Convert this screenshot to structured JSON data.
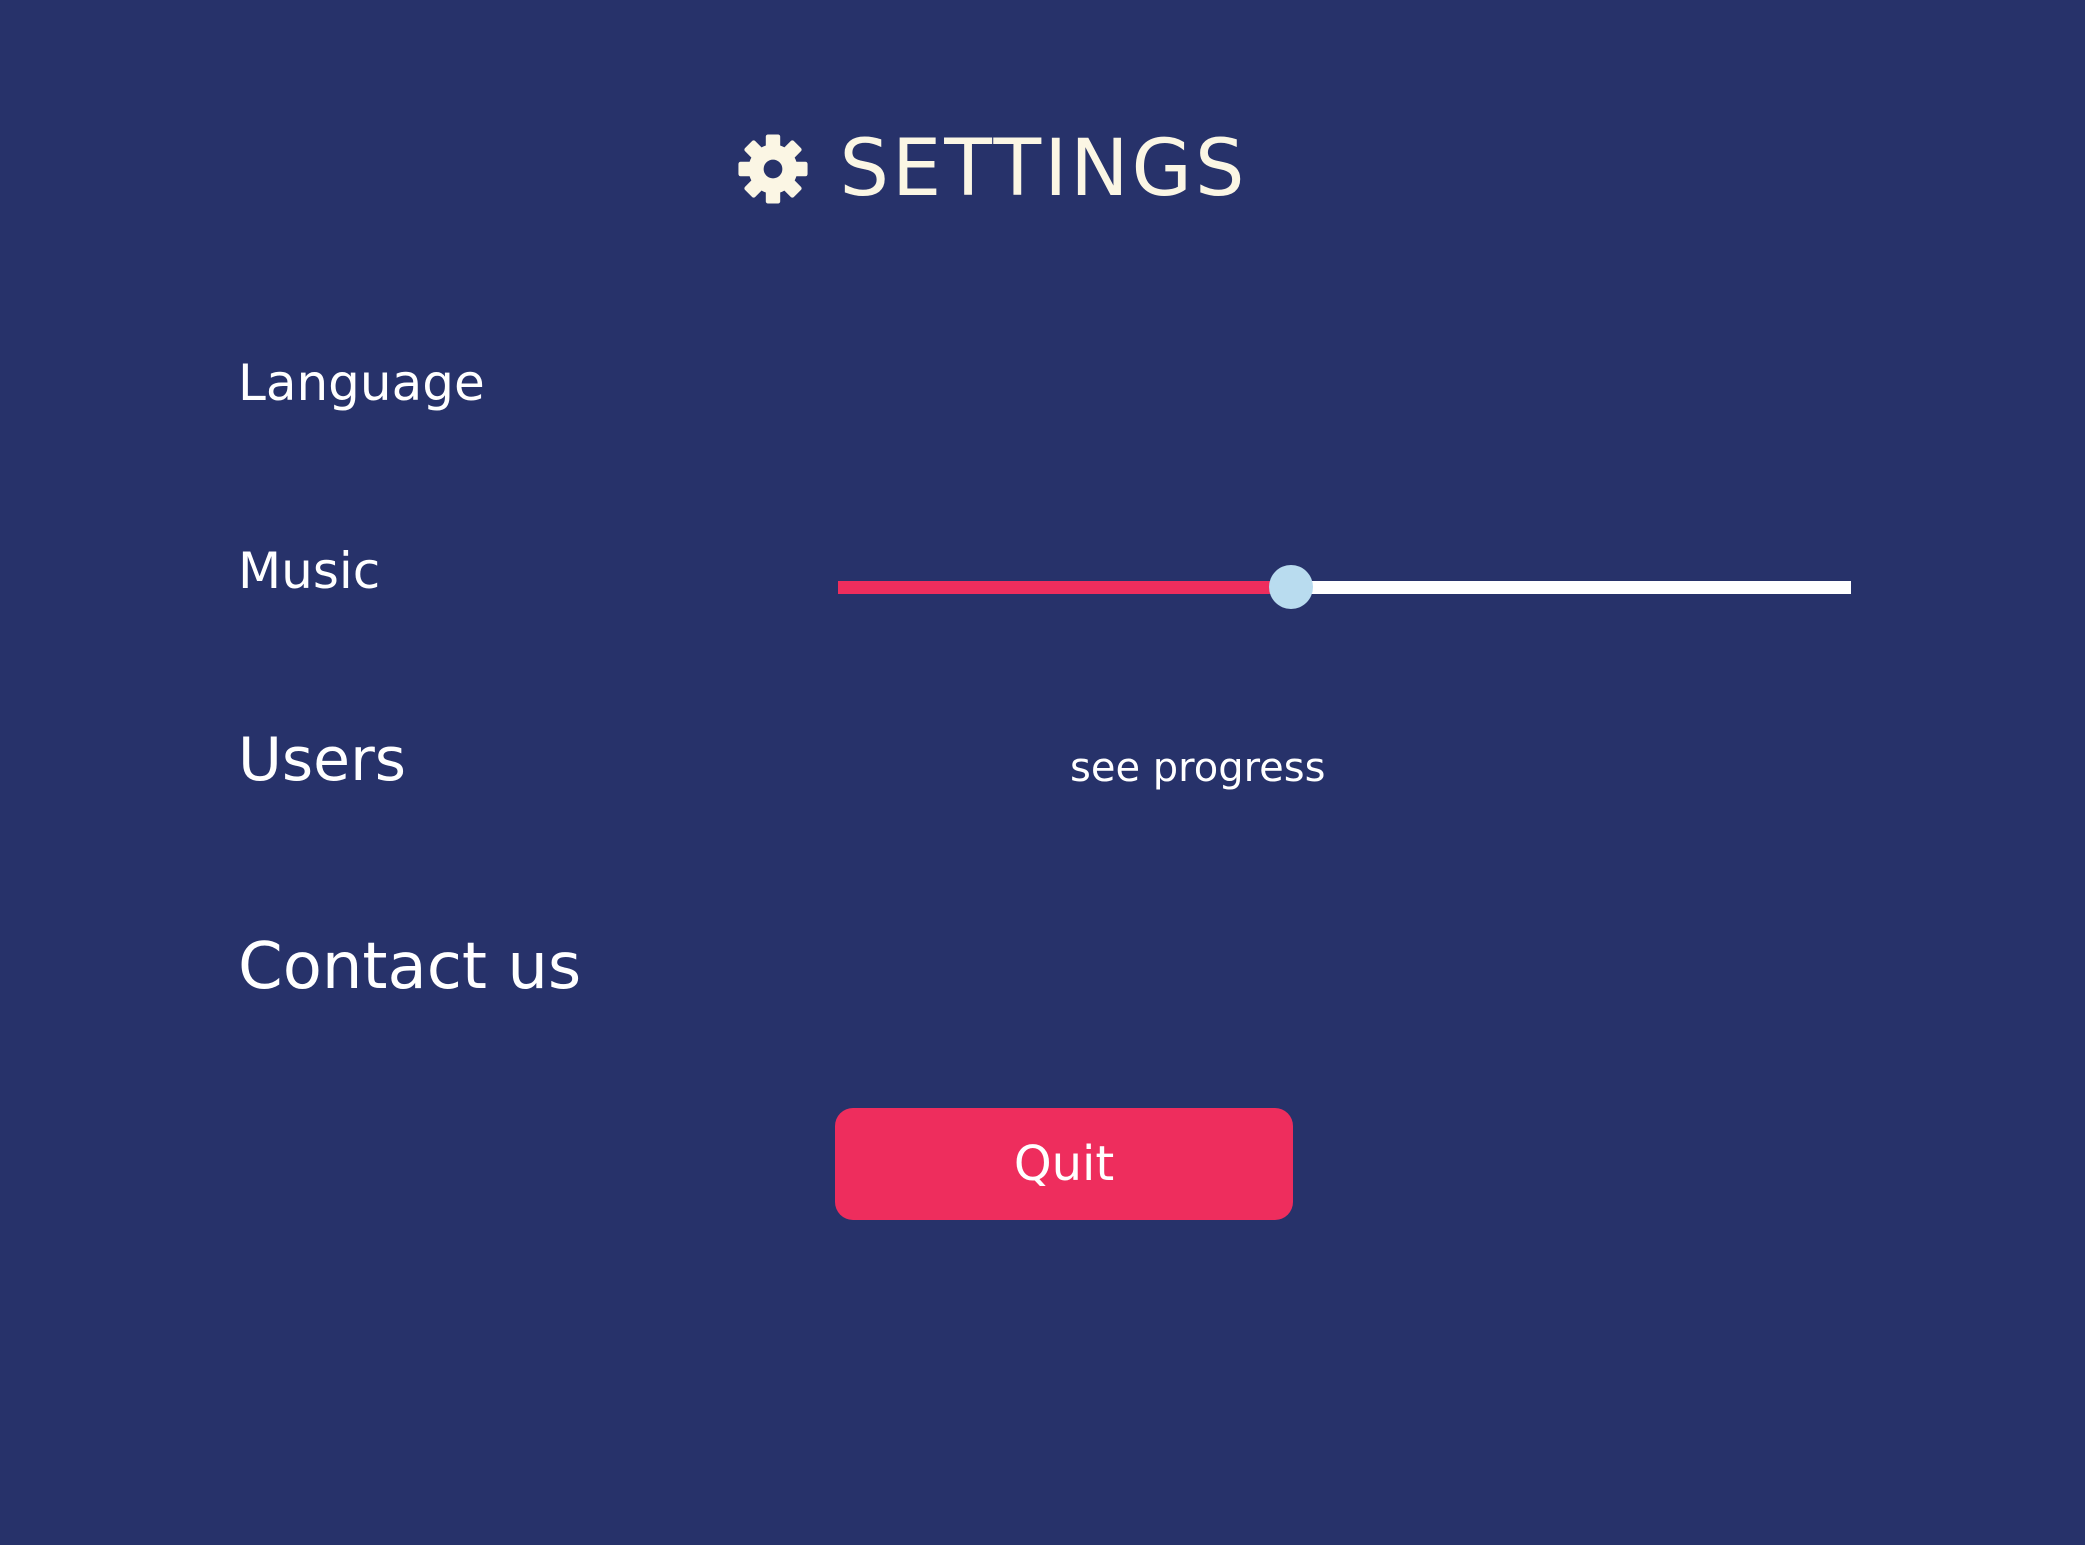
{
  "header": {
    "title": "SETTINGS",
    "icon": "gear-icon"
  },
  "settings": {
    "language_label": "Language",
    "music_label": "Music",
    "music_volume_fraction": 0.447,
    "users_label": "Users",
    "see_progress_link": "see progress",
    "contact_label": "Contact us"
  },
  "actions": {
    "quit_label": "Quit"
  },
  "colors": {
    "background": "#27326a",
    "title": "#fbf6e4",
    "accent": "#ee2d5d",
    "slider_track": "#ffffff",
    "slider_thumb": "#b9dcef"
  }
}
